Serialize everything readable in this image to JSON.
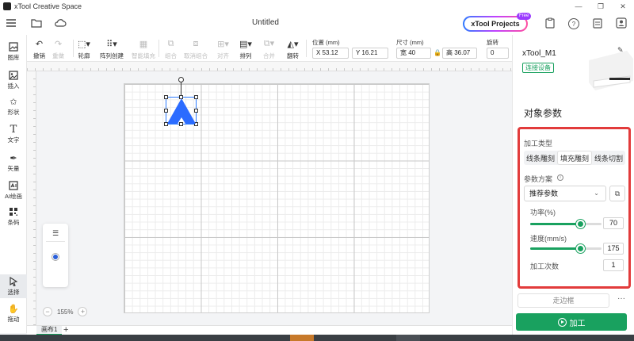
{
  "window": {
    "app_title": "xTool Creative Space",
    "doc_title": "Untitled"
  },
  "topbar": {
    "projects_label": "xTool Projects",
    "free_badge": "Free"
  },
  "left_tools": [
    {
      "label": "图库",
      "icon": "gallery-icon"
    },
    {
      "label": "插入",
      "icon": "insert-icon"
    },
    {
      "label": "形状",
      "icon": "shape-icon"
    },
    {
      "label": "文字",
      "icon": "text-icon"
    },
    {
      "label": "矢量",
      "icon": "vector-pen-icon"
    },
    {
      "label": "AI绘画",
      "icon": "ai-paint-icon"
    },
    {
      "label": "条码",
      "icon": "barcode-icon"
    },
    {
      "label": "选择",
      "icon": "select-cursor-icon"
    },
    {
      "label": "拖动",
      "icon": "drag-hand-icon"
    }
  ],
  "toolbar": {
    "undo": "撤销",
    "redo": "重做",
    "outline": "轮廓",
    "array": "阵列创建",
    "smart_fill": "智能填充",
    "group": "组合",
    "ungroup": "取消组合",
    "align": "对齐",
    "arrange": "排列",
    "combine": "合并",
    "flip": "翻转",
    "position_label": "位置 (mm)",
    "x_value": "X 53.12",
    "y_value": "Y 16.21",
    "size_label": "尺寸 (mm)",
    "width_value": "宽 40",
    "height_value": "高 36.07",
    "rotate_label": "旋转",
    "rotate_value": "0"
  },
  "canvas": {
    "zoom": "155%",
    "zoom_minus": "−",
    "zoom_plus": "+",
    "shape_color": "#2b6bff"
  },
  "tabs": {
    "canvas_tab": "画布1",
    "add": "+"
  },
  "device": {
    "name": "xTool_M1",
    "connect_label": "连接设备"
  },
  "params": {
    "title": "对象参数",
    "process_type_label": "加工类型",
    "process_types": [
      "线条雕刻",
      "填充雕刻",
      "线条切割"
    ],
    "selected_type": "填充雕刻",
    "preset_label": "参数方案",
    "preset_value": "推荐参数",
    "power_label": "功率(%)",
    "power_value": "70",
    "speed_label": "速度(mm/s)",
    "speed_value": "175",
    "passes_label": "加工次数",
    "passes_value": "1",
    "power_fraction": 0.7,
    "speed_fraction": 0.7
  },
  "actions": {
    "frame_label": "走边框",
    "more_label": "···",
    "process_label": "加工"
  },
  "colors": {
    "accent": "#19a15f",
    "highlight": "#e23b3b",
    "selection": "#2b7bff"
  }
}
